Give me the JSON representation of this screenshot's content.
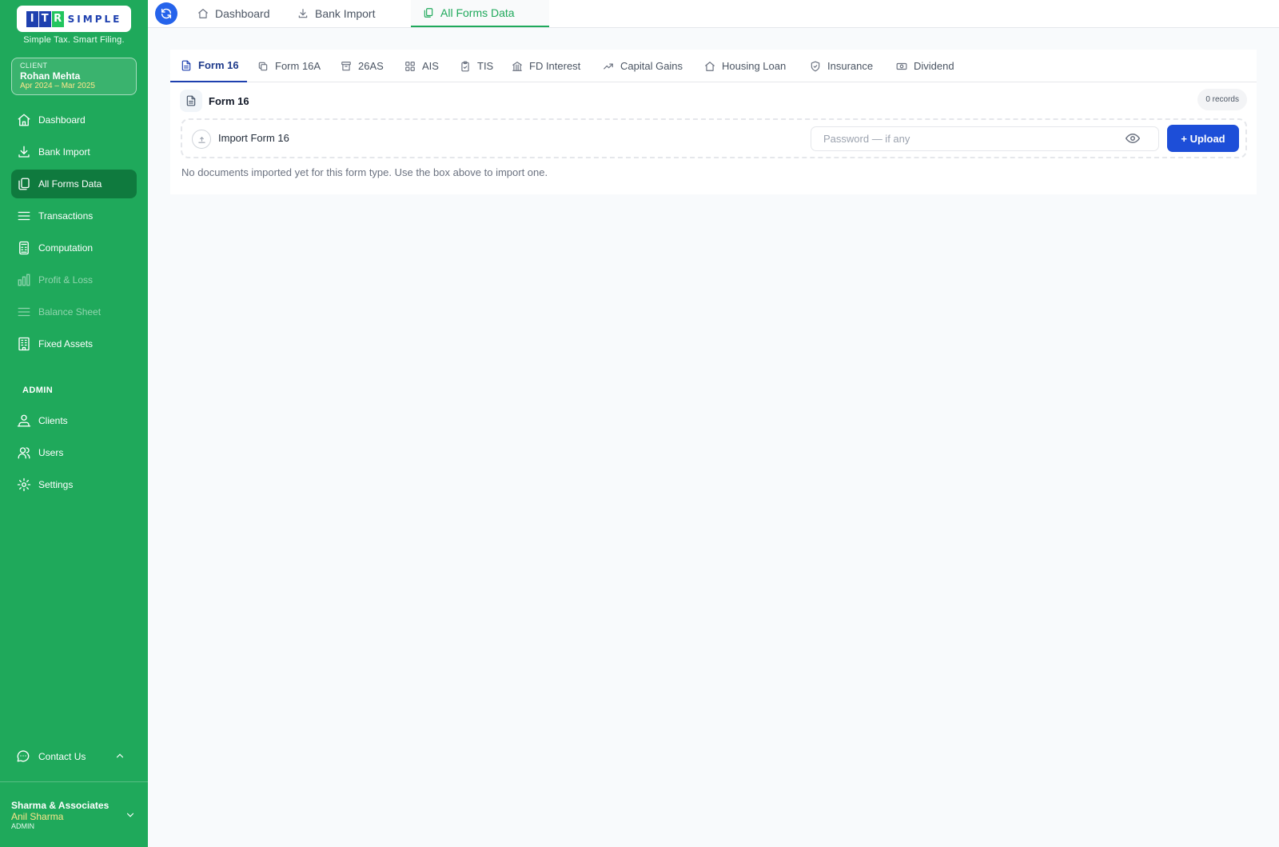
{
  "brand": {
    "letters_boxed": [
      "I",
      "T",
      "R"
    ],
    "letters_plain": "SIMPLE",
    "tagline": "Simple Tax. Smart Filing."
  },
  "client": {
    "label": "CLIENT",
    "name": "Rohan Mehta",
    "period": "Apr 2024 – Mar 2025"
  },
  "sidebar": {
    "items": [
      {
        "label": "Dashboard",
        "icon": "home-icon"
      },
      {
        "label": "Bank Import",
        "icon": "download-icon"
      },
      {
        "label": "All Forms Data",
        "icon": "copy-icon",
        "active": true
      },
      {
        "label": "Transactions",
        "icon": "list-icon"
      },
      {
        "label": "Computation",
        "icon": "calculator-icon"
      },
      {
        "label": "Profit & Loss",
        "icon": "bar-chart-icon",
        "disabled": true
      },
      {
        "label": "Balance Sheet",
        "icon": "list-icon",
        "disabled": true
      },
      {
        "label": "Fixed Assets",
        "icon": "building-icon"
      }
    ],
    "admin_label": "ADMIN",
    "admin_items": [
      {
        "label": "Clients",
        "icon": "clients-icon"
      },
      {
        "label": "Users",
        "icon": "users-icon"
      },
      {
        "label": "Settings",
        "icon": "gear-icon"
      }
    ],
    "contact_label": "Contact Us"
  },
  "org": {
    "name": "Sharma & Associates",
    "user": "Anil Sharma",
    "role": "ADMIN"
  },
  "top_tabs": [
    {
      "label": "Dashboard",
      "icon": "home-icon"
    },
    {
      "label": "Bank Import",
      "icon": "download-icon"
    },
    {
      "label": "All Forms Data",
      "icon": "copy-icon",
      "active": true
    }
  ],
  "form_tabs": [
    {
      "label": "Form 16",
      "active": true
    },
    {
      "label": "Form 16A"
    },
    {
      "label": "26AS"
    },
    {
      "label": "AIS"
    },
    {
      "label": "TIS"
    },
    {
      "label": "FD Interest"
    },
    {
      "label": "Capital Gains"
    },
    {
      "label": "Housing Loan"
    },
    {
      "label": "Insurance"
    },
    {
      "label": "Dividend"
    }
  ],
  "section": {
    "title": "Form 16",
    "records": "0 records",
    "import_label": "Import Form 16",
    "password_placeholder": "Password — if any",
    "password_value": "",
    "upload_label": "+ Upload",
    "empty_message": "No documents imported yet for this form type. Use the box above to import one."
  },
  "colors": {
    "sidebar_bg": "#1fa95b",
    "sidebar_active": "#0f7a3e",
    "primary_blue": "#1d4ed8",
    "accent_yellow": "#fde68a"
  }
}
